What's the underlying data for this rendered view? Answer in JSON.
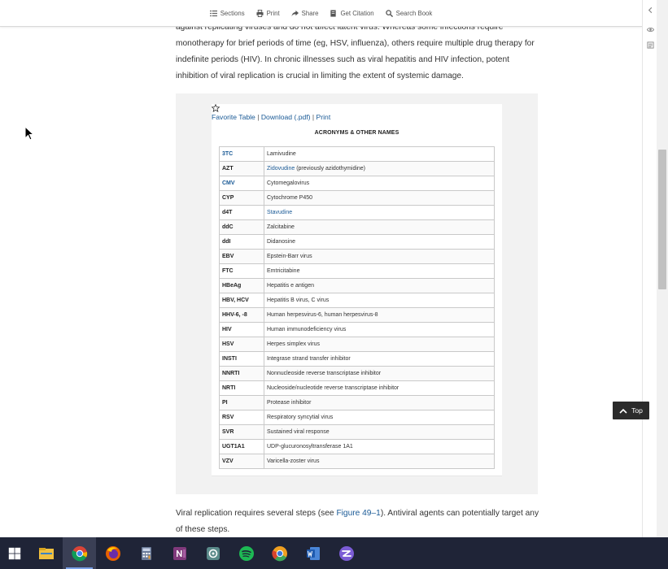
{
  "toolbar": {
    "sections": "Sections",
    "print": "Print",
    "share": "Share",
    "citation": "Get Citation",
    "search": "Search Book"
  },
  "article": {
    "para_top": "against replicating viruses and do not affect latent virus. Whereas some infections require monotherapy for brief periods of time (eg, HSV, influenza), others require multiple drug therapy for indefinite periods (HIV). In chronic illnesses such as viral hepatitis and HIV infection, potent inhibition of viral replication is crucial in limiting the extent of systemic damage.",
    "para_bottom_before": "Viral replication requires several steps (see ",
    "para_bottom_link": "Figure 49–1",
    "para_bottom_after": "). Antiviral agents can potentially target any of these steps."
  },
  "table_links": {
    "favorite": "Favorite Table",
    "sep1": " | ",
    "download": "Download (.pdf)",
    "sep2": " | ",
    "print": "Print"
  },
  "table": {
    "title": "ACRONYMS & OTHER NAMES",
    "rows": [
      {
        "abbr": "3TC",
        "def": "Lamivudine",
        "abbr_link": true
      },
      {
        "abbr": "AZT",
        "def_link": "Zidovudine",
        "def": " (previously azidothymidine)"
      },
      {
        "abbr": "CMV",
        "def": "Cytomegalovirus",
        "abbr_link": true
      },
      {
        "abbr": "CYP",
        "def": "Cytochrome P450"
      },
      {
        "abbr": "d4T",
        "def_link": "Stavudine",
        "def": ""
      },
      {
        "abbr": "ddC",
        "def": "Zalcitabine"
      },
      {
        "abbr": "ddI",
        "def": "Didanosine"
      },
      {
        "abbr": "EBV",
        "def": "Epstein-Barr virus"
      },
      {
        "abbr": "FTC",
        "def": "Emtricitabine"
      },
      {
        "abbr": "HBeAg",
        "def": "Hepatitis e antigen"
      },
      {
        "abbr": "HBV, HCV",
        "def": "Hepatitis B virus, C virus"
      },
      {
        "abbr": "HHV-6, -8",
        "def": "Human herpesvirus-6, human herpesvirus-8"
      },
      {
        "abbr": "HIV",
        "def": "Human immunodeficiency virus"
      },
      {
        "abbr": "HSV",
        "def": "Herpes simplex virus"
      },
      {
        "abbr": "INSTI",
        "def": "Integrase strand transfer inhibitor"
      },
      {
        "abbr": "NNRTI",
        "def": "Nonnucleoside reverse transcriptase inhibitor"
      },
      {
        "abbr": "NRTI",
        "def": "Nucleoside/nucleotide reverse transcriptase inhibitor"
      },
      {
        "abbr": "PI",
        "def": "Protease inhibitor"
      },
      {
        "abbr": "RSV",
        "def": "Respiratory syncytial virus"
      },
      {
        "abbr": "SVR",
        "def": "Sustained viral response"
      },
      {
        "abbr": "UGT1A1",
        "def": "UDP-glucuronosyltransferase 1A1"
      },
      {
        "abbr": "VZV",
        "def": "Varicella-zoster virus"
      }
    ]
  },
  "top_button": {
    "label": "Top"
  },
  "icons": {
    "sections": "list-icon",
    "print": "print-icon",
    "share": "share-icon",
    "citation": "document-icon",
    "search": "search-icon",
    "side_collapse": "chevron-left-icon",
    "side_eye": "eye-icon",
    "side_notes": "notes-icon",
    "favorite": "star-outline-icon",
    "top": "chevron-up-icon",
    "cursor": "mouse-pointer-icon"
  },
  "taskbar": {
    "apps": [
      "windows-start-icon",
      "file-explorer-icon",
      "chrome-icon",
      "firefox-icon",
      "calculator-icon",
      "onenote-icon",
      "settings-app-icon",
      "spotify-icon",
      "chrome-canary-icon",
      "word-icon",
      "app-icon"
    ]
  },
  "colors": {
    "link": "#1a5a96",
    "taskbar": "#1f2437",
    "table_box": "#f2f2f2",
    "top_button": "#2b2b2b"
  }
}
